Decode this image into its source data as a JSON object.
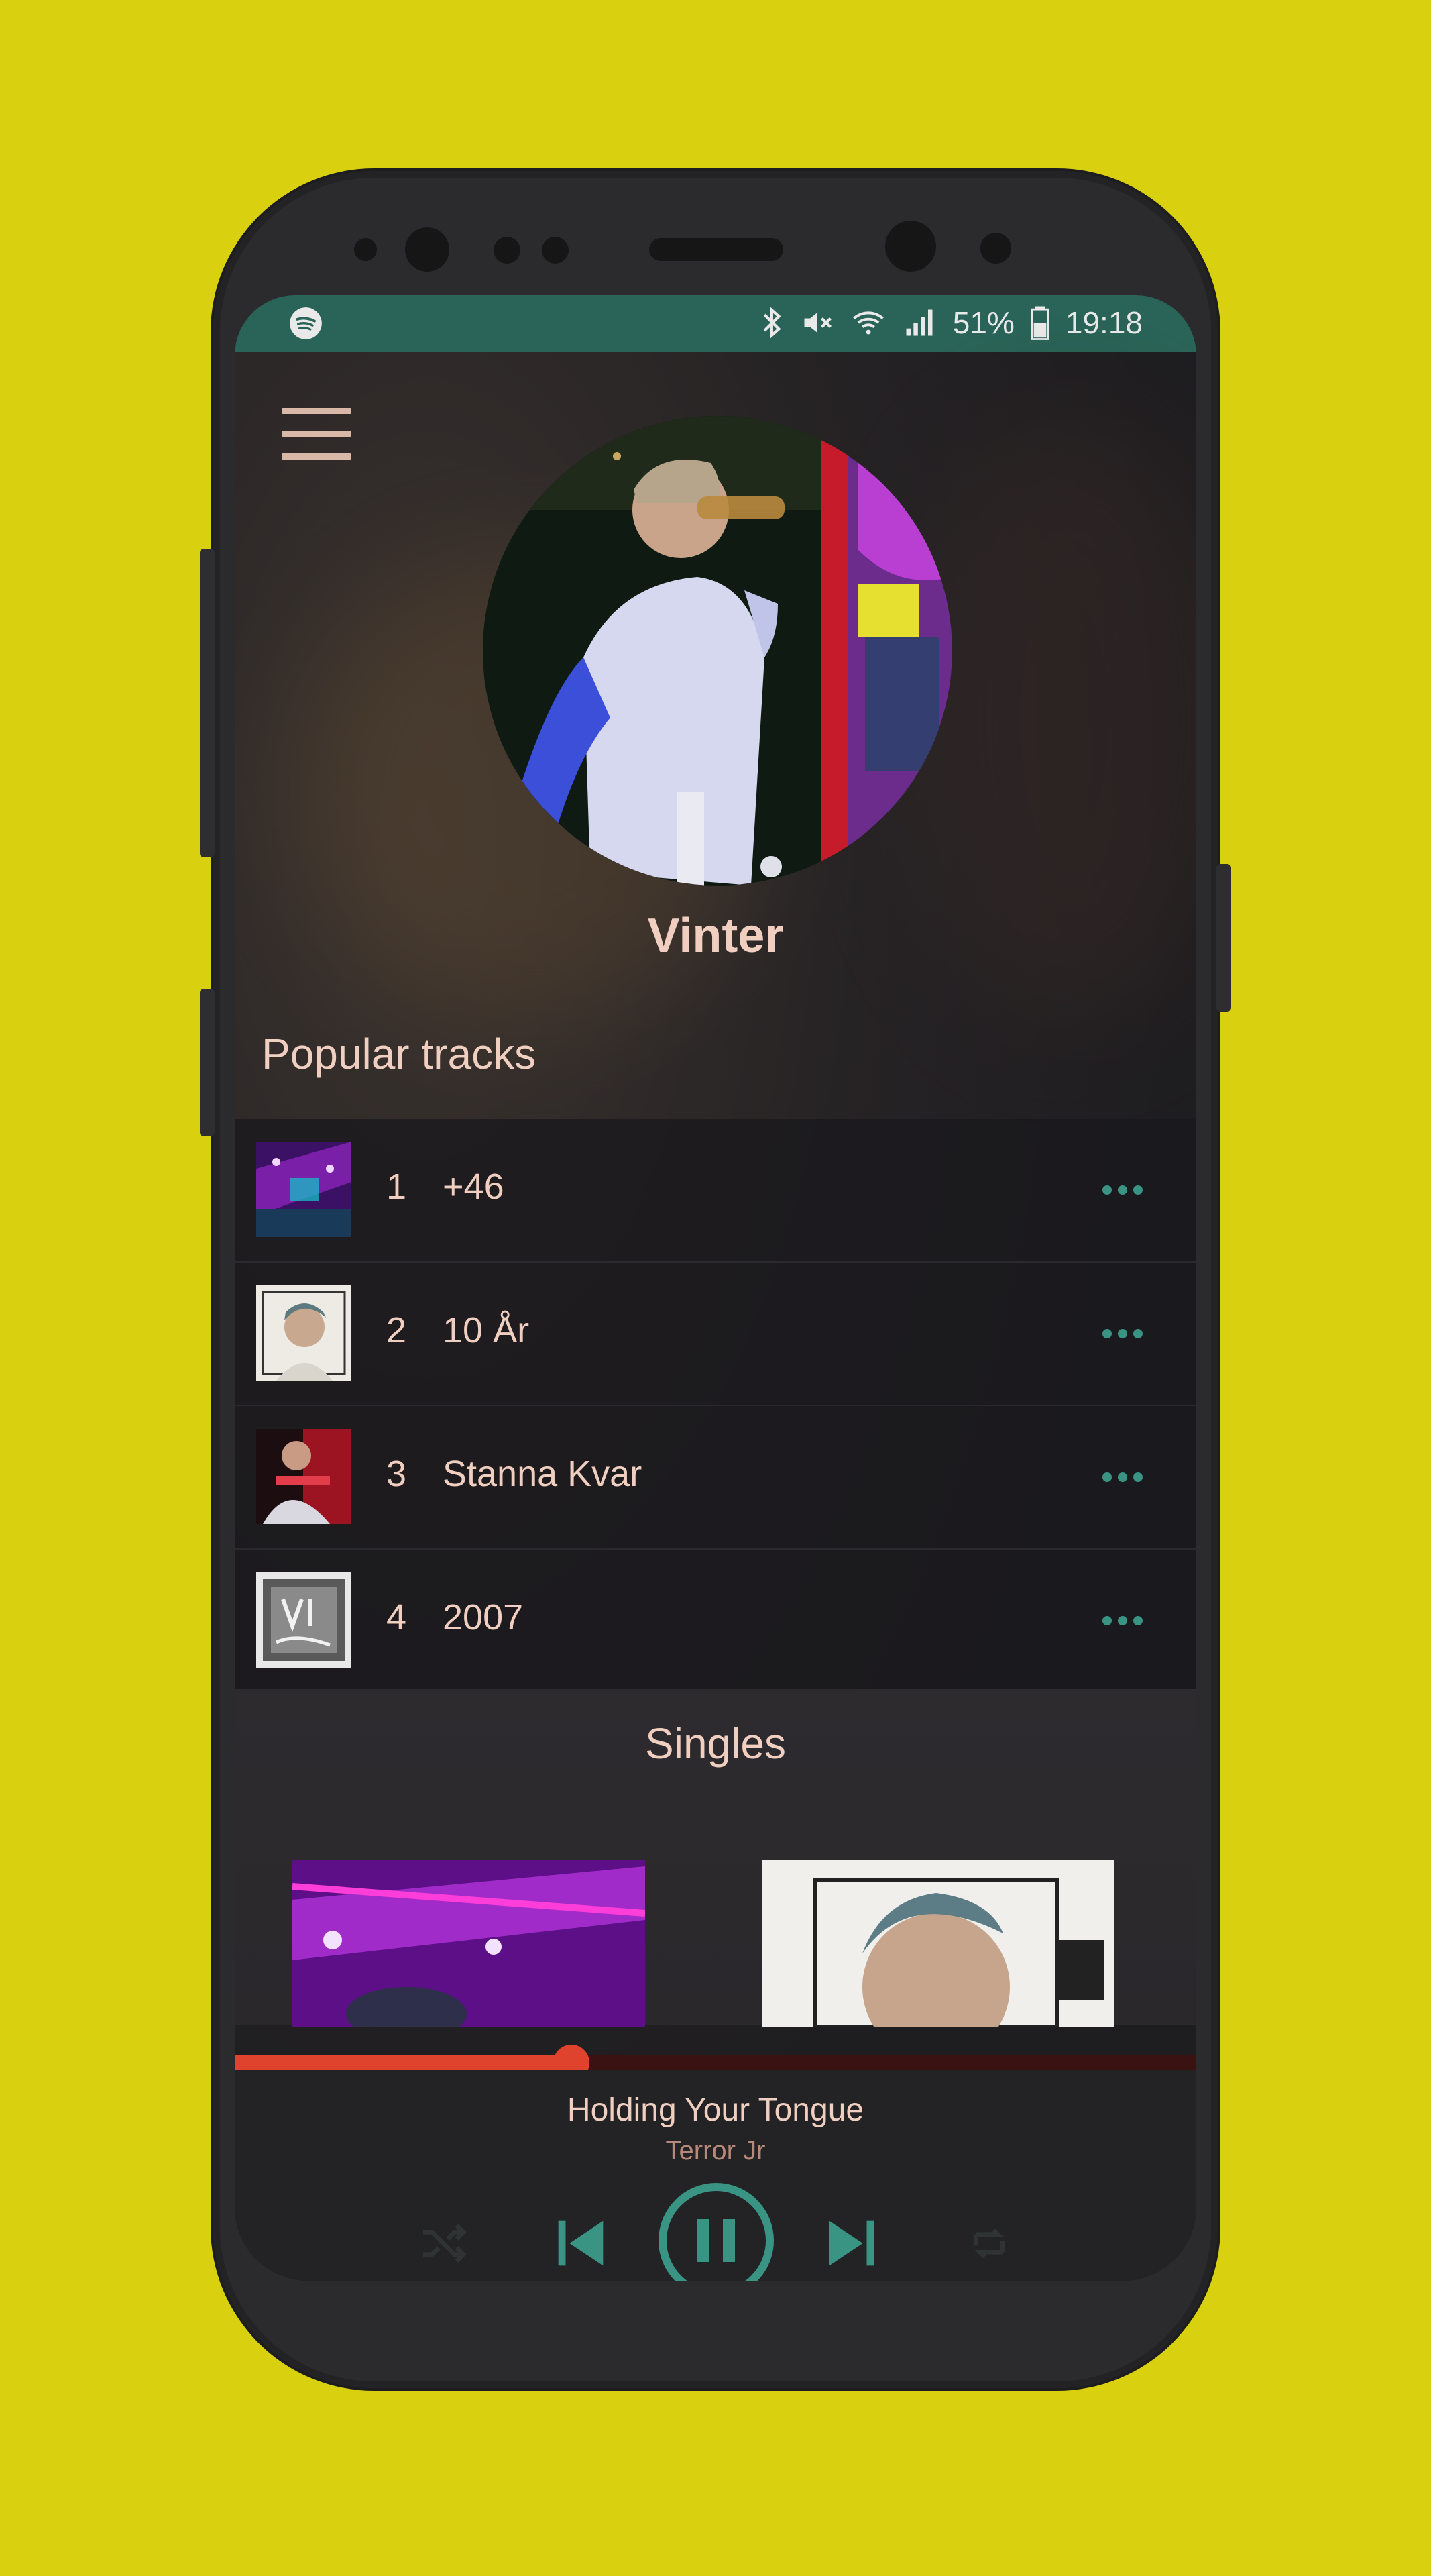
{
  "status": {
    "app_icon": "spotify-icon",
    "battery": "51%",
    "time": "19:18",
    "icons": [
      "bluetooth-icon",
      "mute-icon",
      "wifi-icon",
      "signal-icon",
      "battery-icon"
    ]
  },
  "artist": {
    "name": "Vinter"
  },
  "popular": {
    "title": "Popular tracks",
    "tracks": [
      {
        "num": "1",
        "title": "+46"
      },
      {
        "num": "2",
        "title": "10 År"
      },
      {
        "num": "3",
        "title": "Stanna Kvar"
      },
      {
        "num": "4",
        "title": "2007"
      }
    ]
  },
  "singles": {
    "title": "Singles"
  },
  "now_playing": {
    "title": "Holding Your Tongue",
    "artist": "Terror Jr",
    "progress": 0.35
  },
  "colors": {
    "background": "#d9d010",
    "accent": "#3a9483",
    "progress": "#e0432d",
    "statusbar": "#2a6357"
  }
}
